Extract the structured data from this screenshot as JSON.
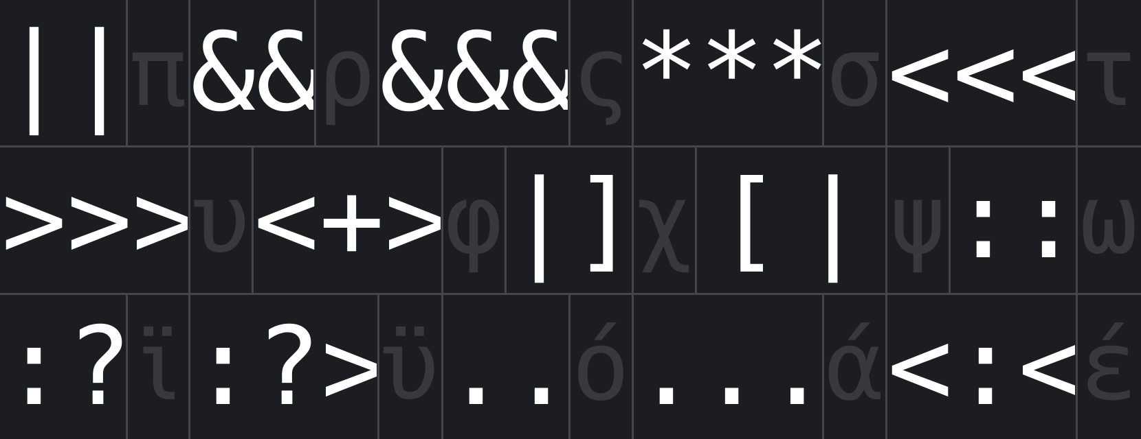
{
  "rows": [
    {
      "cells": [
        {
          "kind": "ligature",
          "chars": [
            "|",
            "|"
          ]
        },
        {
          "kind": "greek",
          "text": "π"
        },
        {
          "kind": "ligature",
          "chars": [
            "&",
            "&"
          ]
        },
        {
          "kind": "greek",
          "text": "ρ"
        },
        {
          "kind": "ligature",
          "chars": [
            "&",
            "&",
            "&"
          ]
        },
        {
          "kind": "greek",
          "text": "ς"
        },
        {
          "kind": "ligature",
          "chars": [
            "*",
            "*",
            "*"
          ]
        },
        {
          "kind": "greek",
          "text": "σ"
        },
        {
          "kind": "ligature",
          "chars": [
            "<",
            "<",
            "<"
          ]
        },
        {
          "kind": "greek",
          "text": "τ"
        }
      ]
    },
    {
      "cells": [
        {
          "kind": "ligature",
          "chars": [
            ">",
            ">",
            ">"
          ]
        },
        {
          "kind": "greek",
          "text": "υ"
        },
        {
          "kind": "ligature",
          "chars": [
            "<",
            "+",
            ">"
          ]
        },
        {
          "kind": "greek",
          "text": "φ"
        },
        {
          "kind": "ligature",
          "chars": [
            "|",
            "]"
          ]
        },
        {
          "kind": "greek",
          "text": "χ"
        },
        {
          "kind": "ligature",
          "chars": [
            "[",
            "|"
          ]
        },
        {
          "kind": "greek",
          "text": "ψ"
        },
        {
          "kind": "ligature",
          "chars": [
            ":",
            ":",
            "="
          ]
        },
        {
          "kind": "greek",
          "text": "ω"
        }
      ]
    },
    {
      "cells": [
        {
          "kind": "ligature",
          "chars": [
            ":",
            "?"
          ]
        },
        {
          "kind": "greek",
          "text": "ϊ"
        },
        {
          "kind": "ligature",
          "chars": [
            ":",
            "?",
            ">"
          ]
        },
        {
          "kind": "greek",
          "text": "ϋ"
        },
        {
          "kind": "ligature",
          "chars": [
            ".",
            "."
          ]
        },
        {
          "kind": "greek",
          "text": "ό"
        },
        {
          "kind": "ligature",
          "chars": [
            ".",
            ".",
            "."
          ]
        },
        {
          "kind": "greek",
          "text": "ά"
        },
        {
          "kind": "ligature",
          "chars": [
            "<",
            ":",
            "<"
          ]
        },
        {
          "kind": "greek",
          "text": "έ"
        }
      ]
    }
  ]
}
